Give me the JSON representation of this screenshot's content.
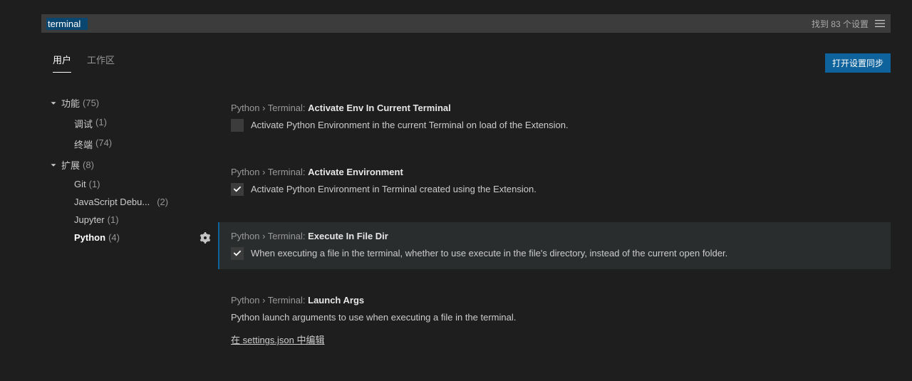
{
  "search": {
    "value": "terminal",
    "found_label": "找到 83 个设置"
  },
  "tabs": {
    "user": "用户",
    "workspace": "工作区"
  },
  "sync_button": "打开设置同步",
  "tree": {
    "g1": {
      "label": "功能",
      "count": "(75)"
    },
    "g1_items": {
      "debug": {
        "label": "调试",
        "count": "(1)"
      },
      "terminal": {
        "label": "终端",
        "count": "(74)"
      }
    },
    "g2": {
      "label": "扩展",
      "count": "(8)"
    },
    "g2_items": {
      "git": {
        "label": "Git",
        "count": "(1)"
      },
      "js": {
        "label": "JavaScript Debu...",
        "count": "(2)"
      },
      "jupyter": {
        "label": "Jupyter",
        "count": "(1)"
      },
      "python": {
        "label": "Python",
        "count": "(4)"
      }
    }
  },
  "settings": {
    "s1": {
      "crumb": "Python › Terminal: ",
      "name": "Activate Env In Current Terminal",
      "desc": "Activate Python Environment in the current Terminal on load of the Extension."
    },
    "s2": {
      "crumb": "Python › Terminal: ",
      "name": "Activate Environment",
      "desc": "Activate Python Environment in Terminal created using the Extension."
    },
    "s3": {
      "crumb": "Python › Terminal: ",
      "name": "Execute In File Dir",
      "desc": "When executing a file in the terminal, whether to use execute in the file's directory, instead of the current open folder."
    },
    "s4": {
      "crumb": "Python › Terminal: ",
      "name": "Launch Args",
      "desc": "Python launch arguments to use when executing a file in the terminal.",
      "edit": "在 settings.json 中编辑"
    }
  }
}
